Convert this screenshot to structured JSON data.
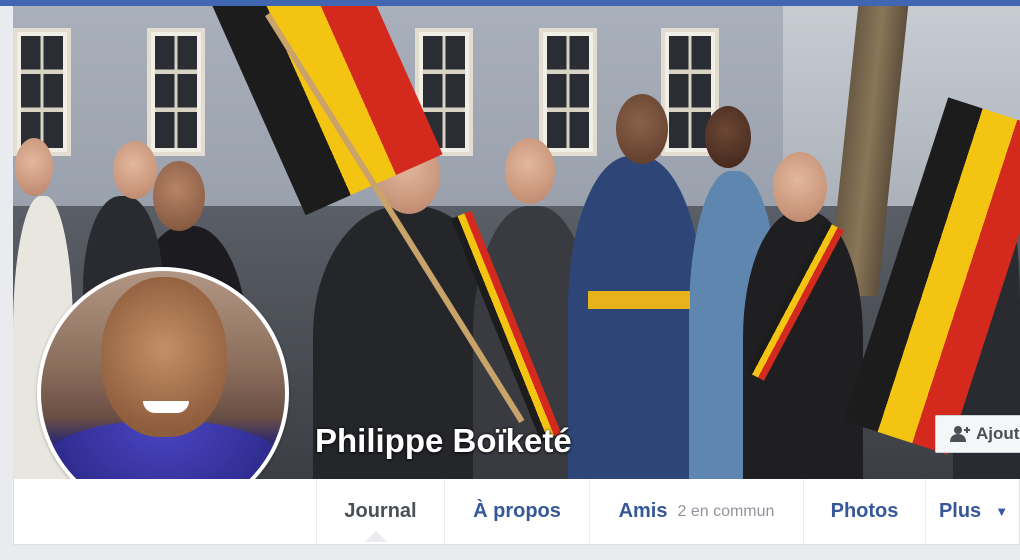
{
  "profile": {
    "name": "Philippe Boïketé",
    "add_friend_label": "Ajout"
  },
  "nav": {
    "tabs": [
      {
        "label": "Journal",
        "active": true
      },
      {
        "label": "À propos"
      },
      {
        "label": "Amis",
        "sub": "2 en commun"
      },
      {
        "label": "Photos"
      },
      {
        "label": "Plus"
      }
    ]
  },
  "icons": {
    "add_friend": "add-friend-icon",
    "more_caret": "chevron-down-icon"
  },
  "colors": {
    "brand": "#4267b2",
    "link": "#365899",
    "active_tab": "#4b4f56"
  }
}
